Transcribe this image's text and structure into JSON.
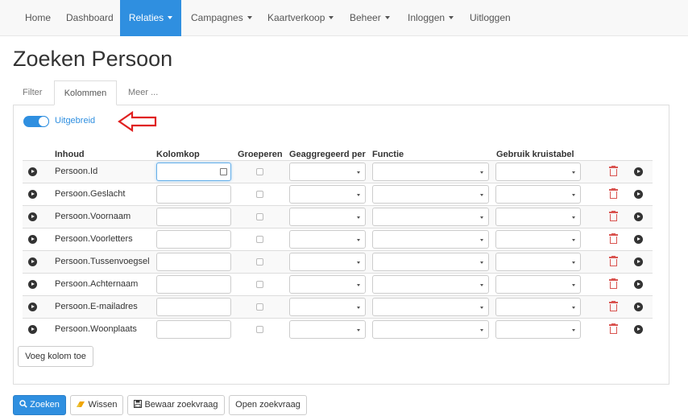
{
  "nav": {
    "items": [
      {
        "label": "Home",
        "caret": false,
        "active": false
      },
      {
        "label": "Dashboard",
        "caret": false,
        "active": false
      },
      {
        "label": "Relaties",
        "caret": true,
        "active": true
      },
      {
        "label": "Campagnes",
        "caret": true,
        "active": false
      },
      {
        "label": "Kaartverkoop",
        "caret": true,
        "active": false
      },
      {
        "label": "Beheer",
        "caret": true,
        "active": false
      },
      {
        "label": "Inloggen",
        "caret": true,
        "active": false
      },
      {
        "label": "Uitloggen",
        "caret": false,
        "active": false
      }
    ]
  },
  "page": {
    "title": "Zoeken Persoon"
  },
  "tabs": [
    {
      "label": "Filter",
      "active": false
    },
    {
      "label": "Kolommen",
      "active": true
    },
    {
      "label": "Meer ...",
      "active": false
    }
  ],
  "toggle": {
    "label": "Uitgebreid",
    "on": true
  },
  "table": {
    "headers": {
      "inhoud": "Inhoud",
      "kolomkop": "Kolomkop",
      "groeperen": "Groeperen",
      "geaggregeerd": "Geaggregeerd per",
      "functie": "Functie",
      "kruistabel": "Gebruik kruistabel"
    },
    "rows": [
      {
        "inhoud": "Persoon.Id"
      },
      {
        "inhoud": "Persoon.Geslacht"
      },
      {
        "inhoud": "Persoon.Voornaam"
      },
      {
        "inhoud": "Persoon.Voorletters"
      },
      {
        "inhoud": "Persoon.Tussenvoegsel"
      },
      {
        "inhoud": "Persoon.Achternaam"
      },
      {
        "inhoud": "Persoon.E-mailadres"
      },
      {
        "inhoud": "Persoon.Woonplaats"
      }
    ]
  },
  "buttons": {
    "add_column": "Voeg kolom toe",
    "search": "Zoeken",
    "clear": "Wissen",
    "save": "Bewaar zoekvraag",
    "open": "Open zoekvraag"
  },
  "colors": {
    "accent": "#2f8fe0",
    "danger": "#d9534f",
    "annotation": "#e02020"
  },
  "icons": [
    "search-icon",
    "eraser-icon",
    "floppy-icon",
    "trash-icon",
    "circle-arrow-right-icon",
    "keyboard-icon"
  ]
}
